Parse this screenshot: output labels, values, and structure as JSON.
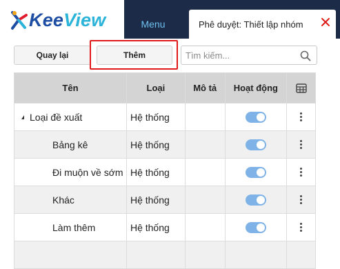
{
  "app": {
    "logo": {
      "part1": "Kee",
      "part2": "View"
    },
    "nav": {
      "menu_label": "Menu"
    },
    "active_tab": {
      "label": "Phê duyệt: Thiết lập nhóm"
    }
  },
  "toolbar": {
    "back_label": "Quay lại",
    "add_label": "Thêm",
    "search_placeholder": "Tìm kiếm...",
    "search_value": ""
  },
  "table": {
    "columns": [
      "Tên",
      "Loại",
      "Mô tả",
      "Hoạt động"
    ],
    "rows": [
      {
        "name": "Loại đề xuất",
        "type": "Hệ thống",
        "description": "",
        "active": true,
        "expanded": true,
        "level": 0
      },
      {
        "name": "Bảng kê",
        "type": "Hệ thống",
        "description": "",
        "active": true,
        "level": 1
      },
      {
        "name": "Đi muộn về sớm",
        "type": "Hệ thống",
        "description": "",
        "active": true,
        "level": 1
      },
      {
        "name": "Khác",
        "type": "Hệ thống",
        "description": "",
        "active": true,
        "level": 1
      },
      {
        "name": "Làm thêm",
        "type": "Hệ thống",
        "description": "",
        "active": true,
        "level": 1
      }
    ]
  },
  "colors": {
    "nav_bg": "#1c2b48",
    "menu_text": "#6fc0ef",
    "logo_primary": "#1e4ea3",
    "logo_secondary": "#2bb3d9",
    "toggle_on": "#7fb2e6",
    "close_icon": "#e01818",
    "highlight": "#e01818"
  },
  "icons": {
    "tab_close": "close-icon",
    "search": "search-icon",
    "column_chooser": "table-grid-icon",
    "row_menu": "more-vertical-icon",
    "expand": "caret-down-icon"
  }
}
